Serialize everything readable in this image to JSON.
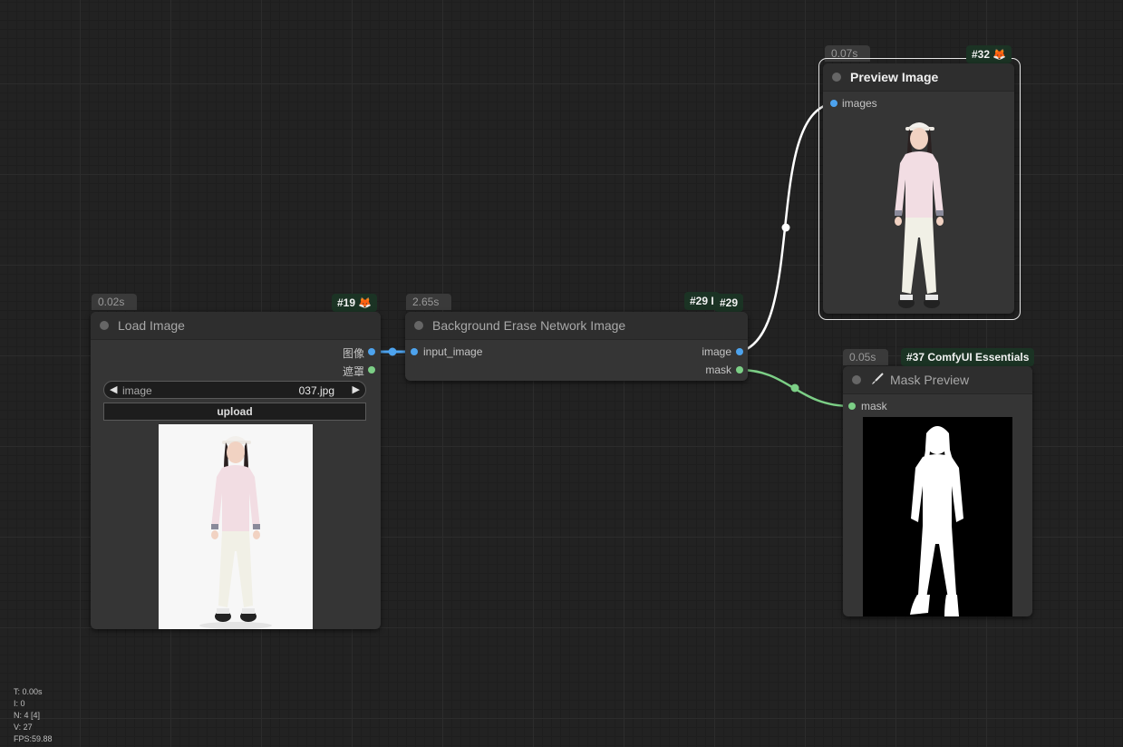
{
  "nodes": {
    "load_image": {
      "time": "0.02s",
      "id_badge": "#19 🦊",
      "title": "Load Image",
      "outputs": [
        "图像",
        "遮罩"
      ],
      "widget_label": "image",
      "widget_value": "037.jpg",
      "upload_label": "upload"
    },
    "bg_erase": {
      "time": "2.65s",
      "id_badge_back": "#29 I",
      "id_badge": "#29",
      "title": "Background Erase Network Image",
      "input": "input_image",
      "outputs": [
        "image",
        "mask"
      ]
    },
    "preview": {
      "time": "0.07s",
      "id_badge": "#32 🦊",
      "title": "Preview Image",
      "input": "images"
    },
    "mask_preview": {
      "time": "0.05s",
      "id_badge": "#37 ComfyUI Essentials",
      "title": "Mask Preview",
      "input": "mask"
    }
  },
  "stats": [
    "T: 0.00s",
    "I: 0",
    "N: 4 [4]",
    "V: 27",
    "FPS:59.88"
  ],
  "colors": {
    "image_link": "#4da3ee",
    "mask_link": "#7ccf86",
    "selected_link": "#ffffff",
    "id_badge_bg": "#1b3324"
  },
  "icons": [
    "fox-icon",
    "brush-icon"
  ]
}
